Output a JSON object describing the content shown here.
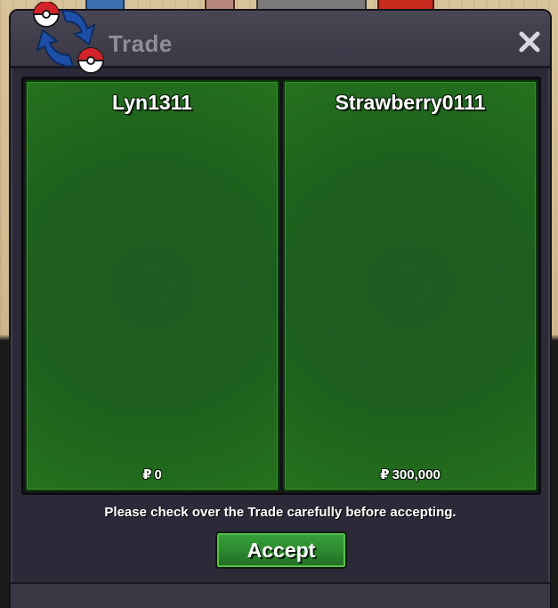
{
  "window": {
    "title": "Trade",
    "close_glyph": "✕",
    "icon": "trade-arrows-icon"
  },
  "offers": [
    {
      "player": "Lyn1311",
      "money_symbol": "₽",
      "money": "0"
    },
    {
      "player": "Strawberry0111",
      "money_symbol": "₽",
      "money": "300,000"
    }
  ],
  "notice": "Please check over the Trade carefully before accepting.",
  "accept_label": "Accept",
  "colors": {
    "panel_green": "#1f5a22",
    "accept_green": "#2d8a2f",
    "window_bg": "#2c2a38",
    "title_text": "#8f8e98"
  }
}
